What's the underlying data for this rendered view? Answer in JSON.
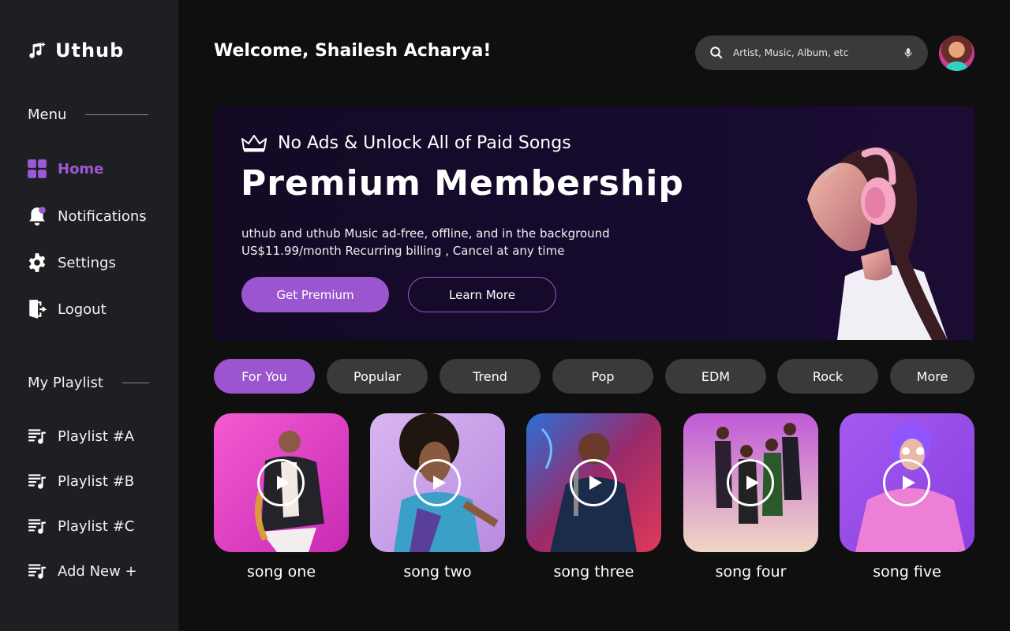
{
  "app": {
    "name": "Uthub"
  },
  "sidebar": {
    "menu_heading": "Menu",
    "menu": [
      {
        "label": "Home",
        "icon": "grid-icon",
        "active": true
      },
      {
        "label": "Notifications",
        "icon": "bell-icon",
        "active": false
      },
      {
        "label": "Settings",
        "icon": "gear-icon",
        "active": false
      },
      {
        "label": "Logout",
        "icon": "logout-icon",
        "active": false
      }
    ],
    "playlist_heading": "My Playlist",
    "playlists": [
      {
        "label": "Playlist #A"
      },
      {
        "label": "Playlist #B"
      },
      {
        "label": "Playlist #C"
      },
      {
        "label": "Add New +"
      }
    ]
  },
  "header": {
    "welcome": "Welcome, Shailesh Acharya!",
    "search_placeholder": "Artist, Music, Album, etc"
  },
  "banner": {
    "tag": "No Ads & Unlock All of Paid Songs",
    "title": "Premium Membership",
    "desc_line1": "uthub and uthub Music ad-free, offline, and in the background",
    "desc_line2": "US$11.99/month Recurring billing , Cancel at any time",
    "primary_button": "Get Premium",
    "secondary_button": "Learn More"
  },
  "tabs": [
    {
      "label": "For You",
      "active": true
    },
    {
      "label": "Popular",
      "active": false
    },
    {
      "label": "Trend",
      "active": false
    },
    {
      "label": "Pop",
      "active": false
    },
    {
      "label": "EDM",
      "active": false
    },
    {
      "label": "Rock",
      "active": false
    },
    {
      "label": "More",
      "active": false
    }
  ],
  "songs": [
    {
      "title": "song one"
    },
    {
      "title": "song two"
    },
    {
      "title": "song three"
    },
    {
      "title": "song four"
    },
    {
      "title": "song five"
    }
  ],
  "colors": {
    "accent": "#9a55cf",
    "sidebar_bg": "#1e1f22",
    "page_bg": "#0f0f10",
    "pill_bg": "#3a3a3c"
  }
}
